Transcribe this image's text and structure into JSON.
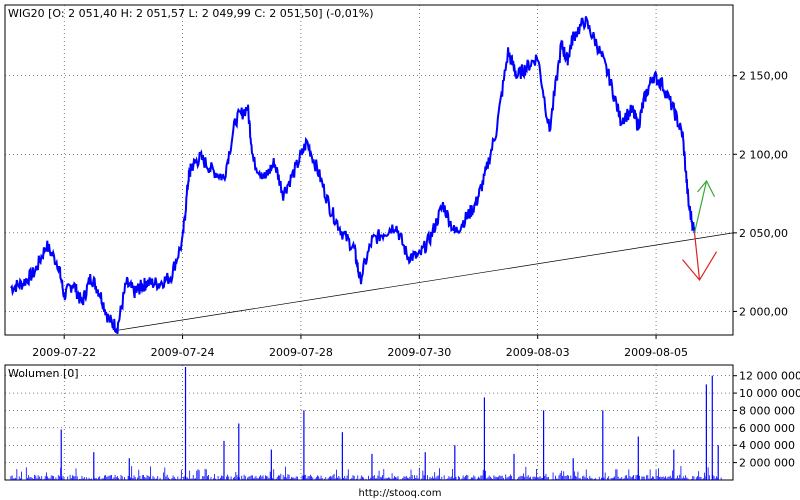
{
  "colors": {
    "price_line": "#0000ff",
    "volume_bars": "#0000ff",
    "trend_line": "#000000",
    "arrow_up": "#33aa33",
    "arrow_down": "#dd2222",
    "frame": "#000000",
    "grid": "#000000"
  },
  "footer": {
    "url": "http://stooq.com"
  },
  "chart_data": [
    {
      "type": "line",
      "title": "WIG20 [O: 2 051,40  H: 2 051,57  L: 2 049,99  C: 2 051,50] (-0,01%)",
      "xlabel": "",
      "ylabel": "",
      "x_tick_labels": [
        "2009-07-22",
        "2009-07-24",
        "2009-07-28",
        "2009-07-30",
        "2009-08-03",
        "2009-08-05"
      ],
      "y_tick_labels": [
        "2 000,00",
        "2 050,00",
        "2 100,00",
        "2 150,00"
      ],
      "y_ticks": [
        2000,
        2050,
        2100,
        2150
      ],
      "ylim": [
        1985,
        2195
      ],
      "x_range_days": [
        0,
        12.3
      ],
      "x_tick_days": [
        1,
        3,
        5,
        7,
        9,
        11
      ],
      "grid": true,
      "series": [
        {
          "x": [
            0.1,
            0.3,
            0.5,
            0.7,
            0.9,
            1.0,
            1.15,
            1.3,
            1.45,
            1.6,
            1.75,
            1.9,
            2.05,
            2.2,
            2.3,
            2.4,
            2.6,
            2.8,
            3.0,
            3.1,
            3.15,
            3.3,
            3.5,
            3.7,
            3.9,
            4.1,
            4.2,
            4.4,
            4.55,
            4.7,
            4.9,
            5.1,
            5.3,
            5.5,
            5.7,
            5.9,
            6.0,
            6.2,
            6.4,
            6.6,
            6.8,
            7.0,
            7.2,
            7.4,
            7.6,
            7.8,
            7.95,
            8.1,
            8.3,
            8.5,
            8.65,
            8.8,
            9.0,
            9.2,
            9.4,
            9.5,
            9.6,
            9.8,
            10.0,
            10.2,
            10.4,
            10.6,
            10.7,
            10.8,
            10.95,
            11.1,
            11.3,
            11.45,
            11.55,
            11.65
          ],
          "values": [
            2015,
            2018,
            2025,
            2042,
            2030,
            2010,
            2018,
            2005,
            2022,
            2012,
            1995,
            1990,
            2018,
            2012,
            2016,
            2018,
            2018,
            2022,
            2045,
            2085,
            2092,
            2098,
            2090,
            2085,
            2122,
            2130,
            2095,
            2085,
            2095,
            2075,
            2090,
            2108,
            2088,
            2065,
            2050,
            2040,
            2020,
            2045,
            2050,
            2055,
            2035,
            2035,
            2048,
            2068,
            2050,
            2060,
            2068,
            2085,
            2115,
            2165,
            2150,
            2155,
            2162,
            2115,
            2170,
            2160,
            2175,
            2185,
            2170,
            2150,
            2122,
            2128,
            2118,
            2135,
            2150,
            2145,
            2128,
            2112,
            2068,
            2050
          ],
          "mark_last": 2051.5
        }
      ],
      "annotations": [
        "trend line from 2009-07-21 low",
        "green up arrow",
        "red down arrow"
      ]
    },
    {
      "type": "bar",
      "title": "Wolumen [0]",
      "y_tick_labels": [
        "2 000 000",
        "4 000 000",
        "6 000 000",
        "8 000 000",
        "10 000 000",
        "12 000 000"
      ],
      "y_ticks": [
        2000000,
        4000000,
        6000000,
        8000000,
        10000000,
        12000000
      ],
      "ylim": [
        0,
        13000000
      ],
      "grid": true,
      "spikes": [
        {
          "x": 0.95,
          "value": 5800000
        },
        {
          "x": 1.5,
          "value": 3200000
        },
        {
          "x": 2.1,
          "value": 2500000
        },
        {
          "x": 3.05,
          "value": 13000000
        },
        {
          "x": 3.7,
          "value": 4500000
        },
        {
          "x": 3.95,
          "value": 6500000
        },
        {
          "x": 4.5,
          "value": 3500000
        },
        {
          "x": 5.05,
          "value": 8000000
        },
        {
          "x": 5.7,
          "value": 5500000
        },
        {
          "x": 6.2,
          "value": 3000000
        },
        {
          "x": 7.1,
          "value": 3200000
        },
        {
          "x": 7.6,
          "value": 4000000
        },
        {
          "x": 8.1,
          "value": 9500000
        },
        {
          "x": 8.6,
          "value": 3000000
        },
        {
          "x": 9.1,
          "value": 8000000
        },
        {
          "x": 9.6,
          "value": 2500000
        },
        {
          "x": 10.1,
          "value": 8000000
        },
        {
          "x": 10.7,
          "value": 5000000
        },
        {
          "x": 11.3,
          "value": 3500000
        },
        {
          "x": 11.85,
          "value": 11000000
        },
        {
          "x": 11.95,
          "value": 12000000
        },
        {
          "x": 12.05,
          "value": 4000000
        }
      ],
      "base_noise_max": 1000000
    }
  ]
}
